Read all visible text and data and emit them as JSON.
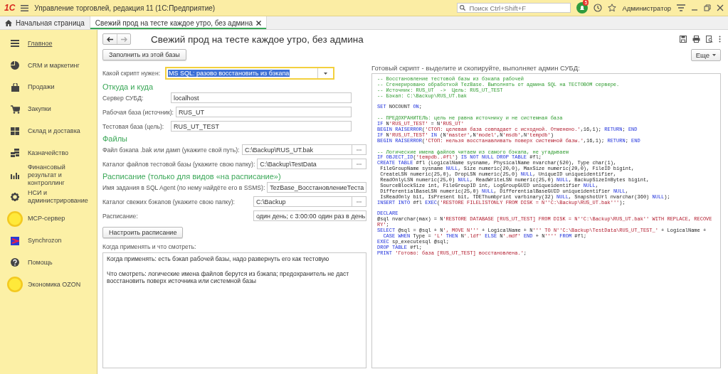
{
  "topbar": {
    "logo": "1С",
    "title": "Управление торговлей, редакция 11  (1С:Предприятие)",
    "search": {
      "placeholder": "Поиск Ctrl+Shift+F"
    },
    "notifications": "5",
    "user": "Администратор"
  },
  "tabs": [
    {
      "label": "Начальная страница",
      "kind": "home",
      "selected": false
    },
    {
      "label": "Свежий прод на тесте каждое утро, без админа",
      "kind": "doc",
      "selected": true
    }
  ],
  "sidebar": {
    "items": [
      {
        "label": "Главное",
        "selected": true
      },
      {
        "label": "CRM и маркетинг",
        "selected": false
      },
      {
        "label": "Продажи",
        "selected": false
      },
      {
        "label": "Закупки",
        "selected": false
      },
      {
        "label": "Склад и доставка",
        "selected": false
      },
      {
        "label": "Казначейство",
        "selected": false
      },
      {
        "label": "Финансовый результат и контроллинг",
        "selected": false
      },
      {
        "label": "НСИ и администрирование",
        "selected": false
      },
      {
        "label": "MCP-сервер",
        "selected": false
      },
      {
        "label": "Synchrozon",
        "selected": false
      },
      {
        "label": "Помощь",
        "selected": false
      },
      {
        "label": "Экономика OZON",
        "selected": false
      }
    ]
  },
  "form": {
    "title": "Свежий прод на тесте каждое утро, без админа",
    "fill_button": "Заполнить из этой базы",
    "more_button": "Еще",
    "script_type": {
      "label": "Какой скрипт нужен:",
      "value": "MS SQL: разово восстановить из бэкапа",
      "focused": true
    },
    "groups": [
      {
        "title": "Откуда и куда",
        "fields": [
          {
            "label": "Сервер СУБД:",
            "value": "localhost",
            "kind": "text"
          },
          {
            "label": "Рабочая база (источник):",
            "value": "RUS_UT",
            "kind": "text"
          },
          {
            "label": "Тестовая база (цель):",
            "value": "RUS_UT_TEST",
            "kind": "text"
          }
        ]
      },
      {
        "title": "Файлы",
        "fields": [
          {
            "label": "Файл бэкапа .bak или дамп (укажите свой путь):",
            "value": "C:\\Backup\\RUS_UT.bak",
            "kind": "file"
          },
          {
            "label": "Каталог файлов тестовой базы (укажите свою папку):",
            "value": "C:\\Backup\\TestData",
            "kind": "file"
          }
        ]
      },
      {
        "title": "Расписание (только для видов «на расписание»)",
        "fields": [
          {
            "label": "Имя задания в SQL Agent (по нему найдёте его в SSMS):",
            "value": "TezBase_ВосстановлениеТеста",
            "kind": "text"
          },
          {
            "label": "Каталог свежих бэкапов (укажите свою папку):",
            "value": "C:\\Backup",
            "kind": "file"
          },
          {
            "label": "Расписание:",
            "value": "один день; с 3:00:00 один раз в день",
            "kind": "text"
          }
        ]
      }
    ],
    "schedule_button": "Настроить расписание",
    "notes": {
      "label": "Когда применять и что смотреть:",
      "paragraphs": [
        "Когда применять: есть бэкап рабочей базы, надо развернуть его как тестовую",
        "Что смотреть: логические имена файлов берутся из бэкапа; предохранитель не даст восстановить поверх источника или системной базы"
      ]
    }
  },
  "script": {
    "label": "Готовый скрипт - выделите и скопируйте, выполняет админ СУБД:",
    "lines": [
      {
        "kind": "comment",
        "text": "-- Восстановление тестовой базы из бэкапа рабочей"
      },
      {
        "kind": "comment",
        "text": "-- Сгенерировано обработкой TezBase. Выполнять от админа SQL на ТЕСТОВОМ сервере."
      },
      {
        "kind": "comment",
        "text": "-- Источник: RUS_UT  ->  Цель: RUS_UT_TEST"
      },
      {
        "kind": "comment",
        "text": "-- Бэкап: C:\\Backup\\RUS_UT.bak"
      },
      {
        "kind": "blank"
      },
      {
        "kind": "code",
        "parts": [
          {
            "kind": "keyword",
            "text": "SET"
          },
          {
            "kind": "plain",
            "text": " NOCOUNT "
          },
          {
            "kind": "keyword",
            "text": "ON"
          },
          {
            "kind": "plain",
            "text": ";"
          }
        ]
      },
      {
        "kind": "blank"
      },
      {
        "kind": "comment",
        "text": "-- ПРЕДОХРАНИТЕЛЬ: цель не равна источнику и не системная база"
      },
      {
        "kind": "code",
        "parts": [
          {
            "kind": "keyword",
            "text": "IF"
          },
          {
            "kind": "plain",
            "text": " N"
          },
          {
            "kind": "string",
            "text": "'RUS_UT_TEST'"
          },
          {
            "kind": "plain",
            "text": " = N"
          },
          {
            "kind": "string",
            "text": "'RUS_UT'"
          }
        ]
      },
      {
        "kind": "code",
        "parts": [
          {
            "kind": "keyword",
            "text": "BEGIN RAISERROR"
          },
          {
            "kind": "plain",
            "text": "("
          },
          {
            "kind": "string",
            "text": "'СТОП: целевая база совпадает с исходной. Отменено.'"
          },
          {
            "kind": "plain",
            "text": ",16,1); "
          },
          {
            "kind": "keyword",
            "text": "RETURN"
          },
          {
            "kind": "plain",
            "text": "; "
          },
          {
            "kind": "keyword",
            "text": "END"
          }
        ]
      },
      {
        "kind": "code",
        "parts": [
          {
            "kind": "keyword",
            "text": "IF"
          },
          {
            "kind": "plain",
            "text": " N"
          },
          {
            "kind": "string",
            "text": "'RUS_UT_TEST'"
          },
          {
            "kind": "keyword",
            "text": " IN "
          },
          {
            "kind": "plain",
            "text": "(N"
          },
          {
            "kind": "string",
            "text": "'master'"
          },
          {
            "kind": "plain",
            "text": ",N"
          },
          {
            "kind": "string",
            "text": "'model'"
          },
          {
            "kind": "plain",
            "text": ",N"
          },
          {
            "kind": "string",
            "text": "'msdb'"
          },
          {
            "kind": "plain",
            "text": ",N"
          },
          {
            "kind": "string",
            "text": "'tempdb'"
          },
          {
            "kind": "plain",
            "text": ")"
          }
        ]
      },
      {
        "kind": "code",
        "parts": [
          {
            "kind": "keyword",
            "text": "BEGIN RAISERROR"
          },
          {
            "kind": "plain",
            "text": "("
          },
          {
            "kind": "string",
            "text": "'СТОП: нельзя восстанавливать поверх системной базы.'"
          },
          {
            "kind": "plain",
            "text": ",16,1); "
          },
          {
            "kind": "keyword",
            "text": "RETURN"
          },
          {
            "kind": "plain",
            "text": "; "
          },
          {
            "kind": "keyword",
            "text": "END"
          }
        ]
      },
      {
        "kind": "blank"
      },
      {
        "kind": "comment",
        "text": "-- Логические имена файлов читаем из самого бэкапа, не угадываем"
      },
      {
        "kind": "code",
        "parts": [
          {
            "kind": "keyword",
            "text": "IF OBJECT_ID"
          },
          {
            "kind": "plain",
            "text": "("
          },
          {
            "kind": "string",
            "text": "'tempdb..#fl'"
          },
          {
            "kind": "plain",
            "text": ") "
          },
          {
            "kind": "keyword",
            "text": "IS NOT NULL DROP TABLE"
          },
          {
            "kind": "plain",
            "text": " #fl;"
          }
        ]
      },
      {
        "kind": "code",
        "parts": [
          {
            "kind": "keyword",
            "text": "CREATE TABLE"
          },
          {
            "kind": "plain",
            "text": " #fl (LogicalName sysname, PhysicalName nvarchar(520), Type char(1),"
          }
        ]
      },
      {
        "kind": "code",
        "parts": [
          {
            "kind": "plain",
            "text": " FileGroupName sysname "
          },
          {
            "kind": "keyword",
            "text": "NULL"
          },
          {
            "kind": "plain",
            "text": ", Size numeric(20,0), MaxSize numeric(20,0), FileID bigint,"
          }
        ]
      },
      {
        "kind": "code",
        "parts": [
          {
            "kind": "plain",
            "text": " CreateLSN numeric(25,0), DropLSN numeric(25,0) "
          },
          {
            "kind": "keyword",
            "text": "NULL"
          },
          {
            "kind": "plain",
            "text": ", UniqueID uniqueidentifier,"
          }
        ]
      },
      {
        "kind": "code",
        "parts": [
          {
            "kind": "plain",
            "text": " ReadOnlyLSN numeric(25,0) "
          },
          {
            "kind": "keyword",
            "text": "NULL"
          },
          {
            "kind": "plain",
            "text": ", ReadWriteLSN numeric(25,0) "
          },
          {
            "kind": "keyword",
            "text": "NULL"
          },
          {
            "kind": "plain",
            "text": ", BackupSizeInBytes bigint,"
          }
        ]
      },
      {
        "kind": "code",
        "parts": [
          {
            "kind": "plain",
            "text": " SourceBlockSize int, FileGroupID int, LogGroupGUID uniqueidentifier "
          },
          {
            "kind": "keyword",
            "text": "NULL"
          },
          {
            "kind": "plain",
            "text": ","
          }
        ]
      },
      {
        "kind": "code",
        "parts": [
          {
            "kind": "plain",
            "text": " DifferentialBaseLSN numeric(25,0) "
          },
          {
            "kind": "keyword",
            "text": "NULL"
          },
          {
            "kind": "plain",
            "text": ", DifferentialBaseGUID uniqueidentifier "
          },
          {
            "kind": "keyword",
            "text": "NULL"
          },
          {
            "kind": "plain",
            "text": ","
          }
        ]
      },
      {
        "kind": "code",
        "parts": [
          {
            "kind": "plain",
            "text": " IsReadOnly bit, IsPresent bit, TDEThumbprint varbinary(32) "
          },
          {
            "kind": "keyword",
            "text": "NULL"
          },
          {
            "kind": "plain",
            "text": ", SnapshotUrl nvarchar(360) "
          },
          {
            "kind": "keyword",
            "text": "NULL"
          },
          {
            "kind": "plain",
            "text": ");"
          }
        ]
      },
      {
        "kind": "code",
        "parts": [
          {
            "kind": "keyword",
            "text": "INSERT INTO"
          },
          {
            "kind": "plain",
            "text": " #fl "
          },
          {
            "kind": "keyword",
            "text": "EXEC"
          },
          {
            "kind": "plain",
            "text": "("
          },
          {
            "kind": "string",
            "text": "'RESTORE FILELISTONLY FROM DISK = N''C:\\Backup\\RUS_UT.bak'''"
          },
          {
            "kind": "plain",
            "text": ");"
          }
        ]
      },
      {
        "kind": "blank"
      },
      {
        "kind": "code",
        "parts": [
          {
            "kind": "keyword",
            "text": "DECLARE"
          }
        ]
      },
      {
        "kind": "code",
        "parts": [
          {
            "kind": "plain",
            "text": "@sql nvarchar(max) = N"
          },
          {
            "kind": "string",
            "text": "'RESTORE DATABASE [RUS_UT_TEST] FROM DISK = N''C:\\Backup\\RUS_UT.bak'' WITH REPLACE, RECOVE"
          }
        ]
      },
      {
        "kind": "code",
        "parts": [
          {
            "kind": "string",
            "text": "RY'"
          },
          {
            "kind": "plain",
            "text": ";"
          }
        ]
      },
      {
        "kind": "code",
        "parts": [
          {
            "kind": "keyword",
            "text": "SELECT"
          },
          {
            "kind": "plain",
            "text": " @sql = @sql + N"
          },
          {
            "kind": "string",
            "text": "', MOVE N'''"
          },
          {
            "kind": "plain",
            "text": " + LogicalName + N"
          },
          {
            "kind": "string",
            "text": "''' TO N''C:\\Backup\\TestData\\RUS_UT_TEST_'"
          },
          {
            "kind": "plain",
            "text": " + LogicalName +"
          }
        ]
      },
      {
        "kind": "code",
        "parts": [
          {
            "kind": "keyword",
            "text": "  CASE WHEN"
          },
          {
            "kind": "plain",
            "text": " Type = "
          },
          {
            "kind": "string",
            "text": "'L'"
          },
          {
            "kind": "keyword",
            "text": " THEN "
          },
          {
            "kind": "plain",
            "text": "N"
          },
          {
            "kind": "string",
            "text": "'.ldf'"
          },
          {
            "kind": "keyword",
            "text": " ELSE "
          },
          {
            "kind": "plain",
            "text": "N"
          },
          {
            "kind": "string",
            "text": "'.mdf'"
          },
          {
            "kind": "keyword",
            "text": " END"
          },
          {
            "kind": "plain",
            "text": " + N"
          },
          {
            "kind": "string",
            "text": "''''"
          },
          {
            "kind": "keyword",
            "text": " FROM"
          },
          {
            "kind": "plain",
            "text": " #fl;"
          }
        ]
      },
      {
        "kind": "code",
        "parts": [
          {
            "kind": "keyword",
            "text": "EXEC"
          },
          {
            "kind": "plain",
            "text": " sp_executesql @sql;"
          }
        ]
      },
      {
        "kind": "code",
        "parts": [
          {
            "kind": "keyword",
            "text": "DROP TABLE"
          },
          {
            "kind": "plain",
            "text": " #fl;"
          }
        ]
      },
      {
        "kind": "code",
        "parts": [
          {
            "kind": "keyword",
            "text": "PRINT "
          },
          {
            "kind": "string",
            "text": "'Готово: база [RUS_UT_TEST] восстановлена.'"
          },
          {
            "kind": "plain",
            "text": ";"
          }
        ]
      }
    ]
  }
}
